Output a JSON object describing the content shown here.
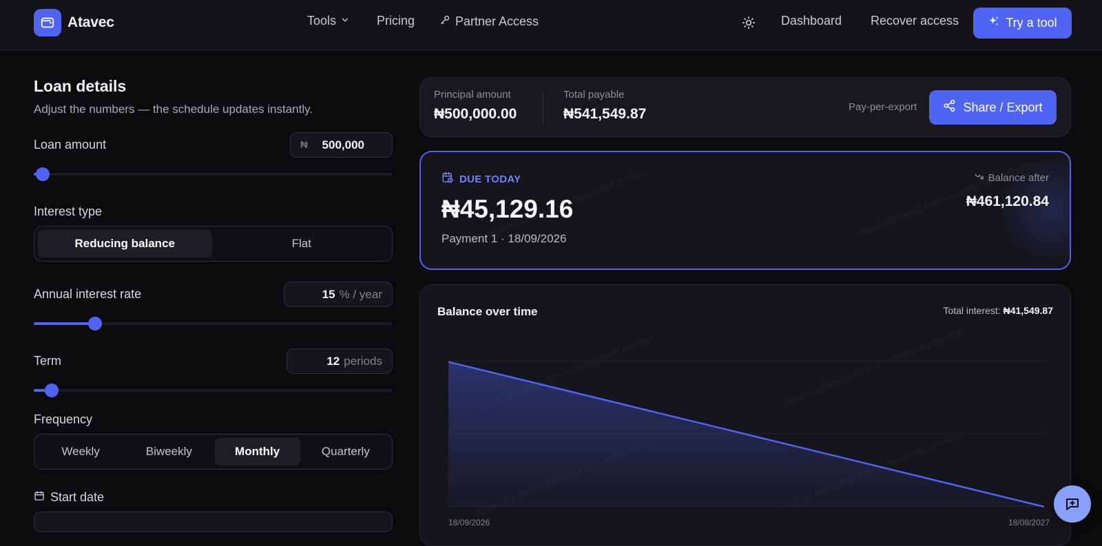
{
  "header": {
    "brand": "Atavec",
    "nav": {
      "tools": "Tools",
      "pricing": "Pricing",
      "partner_access": "Partner Access",
      "dashboard": "Dashboard",
      "recover_access": "Recover access"
    },
    "cta": "Try a tool",
    "icons": {
      "logo": "wallet-icon",
      "tools_chevron": "chevron-down-icon",
      "partner": "key-icon",
      "theme": "sun-icon",
      "cta": "sparkles-icon"
    }
  },
  "loan": {
    "title": "Loan details",
    "subtitle": "Adjust the numbers — the schedule updates instantly.",
    "amount_label": "Loan amount",
    "currency_symbol": "₦",
    "amount_value": "500,000",
    "amount_slider_level": 0.01,
    "interest_type_label": "Interest type",
    "interest_types": [
      "Reducing balance",
      "Flat"
    ],
    "interest_type_selected": "Reducing balance",
    "rate_label": "Annual interest rate",
    "rate_value": "15",
    "rate_unit": "% / year",
    "rate_slider_level": 0.17,
    "term_label": "Term",
    "term_value": "12",
    "term_unit": "periods",
    "term_slider_level": 0.05,
    "frequency_label": "Frequency",
    "frequencies": [
      "Weekly",
      "Biweekly",
      "Monthly",
      "Quarterly"
    ],
    "frequency_selected": "Monthly",
    "start_date_label": "Start date"
  },
  "summary": {
    "principal_label": "Principal amount",
    "principal_value": "₦500,000.00",
    "total_label": "Total payable",
    "total_value": "₦541,549.87",
    "pay_per_export": "Pay-per-export",
    "export_button": "Share / Export"
  },
  "due": {
    "badge": "DUE TODAY",
    "amount": "₦45,129.16",
    "payment_info": "Payment 1 · 18/09/2026",
    "balance_after_label": "Balance after",
    "balance_after_value": "₦461,120.84"
  },
  "chart": {
    "title": "Balance over time",
    "total_interest_label": "Total interest:",
    "total_interest_value": "₦41,549.87"
  },
  "chart_data": {
    "type": "area",
    "title": "Balance over time",
    "x": [
      "18/09/2026",
      "18/08/2027"
    ],
    "series": [
      {
        "values": [
          500000,
          0
        ]
      }
    ],
    "xlabel": "",
    "ylabel": "",
    "ylim": [
      0,
      575000
    ],
    "grid": true,
    "legend": "none",
    "color": "#4f63f5"
  },
  "watermark_text": "atavec.aamonhq.com — unexported preview",
  "colors": {
    "accent": "#4f63f5",
    "background": "#0b0b0e",
    "card": "#15151b"
  },
  "chat_icon": "chat-plus-icon"
}
